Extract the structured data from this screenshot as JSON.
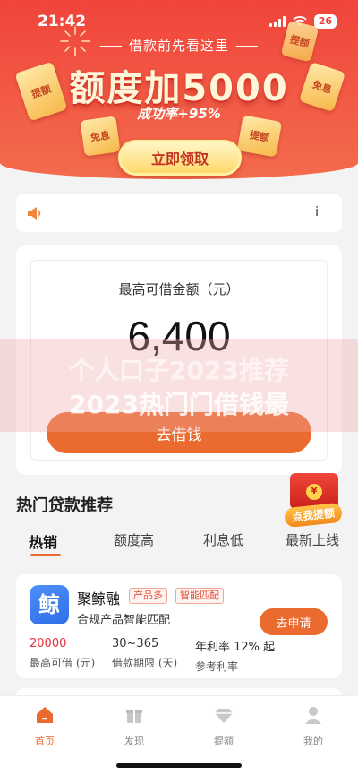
{
  "status_bar": {
    "time": "21:42",
    "battery": "26"
  },
  "banner": {
    "subtitle": "借款前先看这里",
    "title": "额度加5000",
    "rate": "成功率+95%",
    "tickets": [
      "提额",
      "免息",
      "提额",
      "免息",
      "提额"
    ],
    "claim_button": "立即领取"
  },
  "notice": {
    "info_glyph": "ⅰ"
  },
  "limit": {
    "label": "最高可借金额（元）",
    "amount": "6,400",
    "borrow_button": "去借钱"
  },
  "overlay": {
    "line1": "个人口子2023推荐",
    "line2": "2023热门门借钱最"
  },
  "red_packet": {
    "coin": "¥",
    "label": "点我提额"
  },
  "recommend": {
    "title": "热门贷款推荐",
    "tabs": [
      "热销",
      "额度高",
      "利息低",
      "最新上线"
    ],
    "product": {
      "logo_char": "鲸",
      "name": "聚鲸融",
      "tags": [
        "产品多",
        "智能匹配"
      ],
      "desc": "合规产品智能匹配",
      "apply_button": "去申请",
      "stats": [
        {
          "value": "20000",
          "label": "最高可借 (元)"
        },
        {
          "value": "30~365",
          "label": "借款期限 (天)"
        },
        {
          "value": "年利率 12% 起",
          "label": "参考利率"
        }
      ]
    }
  },
  "nav": {
    "items": [
      {
        "label": "首页"
      },
      {
        "label": "发现"
      },
      {
        "label": "提额"
      },
      {
        "label": "我的"
      }
    ]
  },
  "colors": {
    "accent": "#ea6a2f",
    "banner_red": "#f0443a",
    "price_red": "#e5303a"
  }
}
